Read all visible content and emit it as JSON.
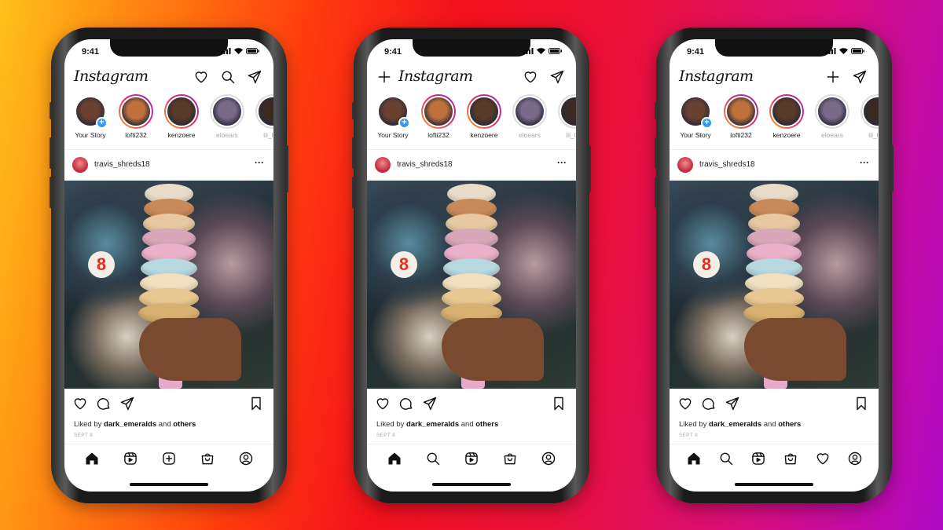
{
  "colors": {
    "background_left": "#ffc21a",
    "background_center": "#f2101c",
    "background_right": "#b00ac6",
    "story_ring": "#e1306c",
    "add_story_badge": "#3897f0"
  },
  "phones": [
    {
      "status_time": "9:41",
      "logo": "Instagram",
      "header_left_icons": [],
      "header_right_icons": [
        "heart",
        "search",
        "send"
      ],
      "stories": [
        {
          "label": "Your Story",
          "type": "own",
          "color": "#6a4030"
        },
        {
          "label": "lofti232",
          "type": "new",
          "color": "#c0703a"
        },
        {
          "label": "kenzoere",
          "type": "new",
          "color": "#5a3a28"
        },
        {
          "label": "eloears",
          "type": "seen",
          "color": "#7a6a8a"
        },
        {
          "label": "lil_lapi",
          "type": "seen",
          "color": "#3a2a20"
        }
      ],
      "post": {
        "username": "travis_shreds18",
        "liked_prefix": "Liked by",
        "liked_user": "dark_emeralds",
        "liked_mid": "and",
        "liked_suffix": "others",
        "date": "SEPT 8"
      },
      "nav_icons": [
        "home",
        "reels",
        "add",
        "shop",
        "profile"
      ]
    },
    {
      "status_time": "9:41",
      "logo": "Instagram",
      "header_left_icons": [
        "add"
      ],
      "header_right_icons": [
        "heart",
        "send"
      ],
      "stories": [
        {
          "label": "Your Story",
          "type": "own",
          "color": "#6a4030"
        },
        {
          "label": "lofti232",
          "type": "new",
          "color": "#c0703a"
        },
        {
          "label": "kenzoere",
          "type": "new",
          "color": "#5a3a28"
        },
        {
          "label": "eloears",
          "type": "seen",
          "color": "#7a6a8a"
        },
        {
          "label": "lil_lapi",
          "type": "seen",
          "color": "#3a2a20"
        }
      ],
      "post": {
        "username": "travis_shreds18",
        "liked_prefix": "Liked by",
        "liked_user": "dark_emeralds",
        "liked_mid": "and",
        "liked_suffix": "others",
        "date": "SEPT 8"
      },
      "nav_icons": [
        "home",
        "search",
        "reels",
        "shop",
        "profile"
      ]
    },
    {
      "status_time": "9:41",
      "logo": "Instagram",
      "header_left_icons": [],
      "header_right_icons": [
        "add",
        "send"
      ],
      "stories": [
        {
          "label": "Your Story",
          "type": "own",
          "color": "#6a4030"
        },
        {
          "label": "lofti232",
          "type": "new",
          "color": "#c0703a"
        },
        {
          "label": "kenzoere",
          "type": "new",
          "color": "#5a3a28"
        },
        {
          "label": "eloears",
          "type": "seen",
          "color": "#7a6a8a"
        },
        {
          "label": "lil_lapi",
          "type": "seen",
          "color": "#3a2a20"
        }
      ],
      "post": {
        "username": "travis_shreds18",
        "liked_prefix": "Liked by",
        "liked_user": "dark_emeralds",
        "liked_mid": "and",
        "liked_suffix": "others",
        "date": "SEPT 8"
      },
      "nav_icons": [
        "home",
        "search",
        "reels",
        "shop",
        "heart",
        "profile"
      ]
    }
  ]
}
